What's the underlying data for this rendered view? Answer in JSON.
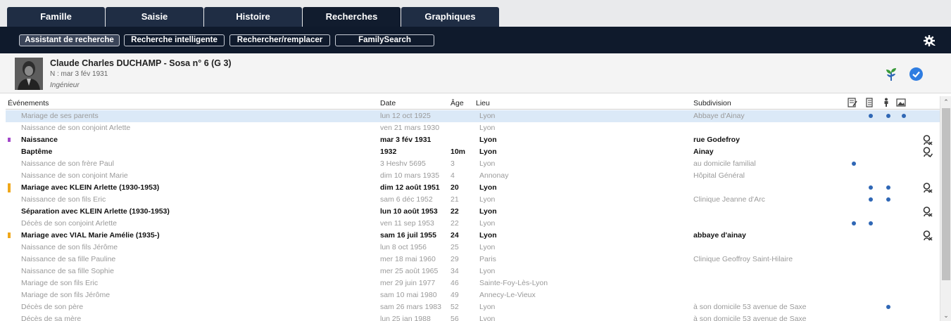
{
  "tabs": [
    "Famille",
    "Saisie",
    "Histoire",
    "Recherches",
    "Graphiques"
  ],
  "active_tab": "Recherches",
  "toolbar": {
    "buttons": [
      "Assistant de recherche",
      "Recherche intelligente",
      "Rechercher/remplacer",
      "FamilySearch"
    ]
  },
  "person": {
    "name": "Claude Charles DUCHAMP - Sosa n° 6 (G 3)",
    "birth": "N : mar 3 fév 1931",
    "occupation": "Ingénieur"
  },
  "table": {
    "headers": [
      "Événements",
      "Date",
      "Âge",
      "Lieu",
      "Subdivision"
    ],
    "header_icons": [
      "notes-icon",
      "sources-icon",
      "person-icon",
      "media-icon"
    ],
    "rows": [
      {
        "event": "Mariage de ses parents",
        "date": "lun 12 oct 1925",
        "age": "",
        "place": "Lyon",
        "sub": "Abbaye d'Ainay"
      },
      {
        "event": "Naissance de son conjoint Arlette",
        "date": "ven 21 mars 1930",
        "age": "",
        "place": "Lyon",
        "sub": ""
      },
      {
        "event": "Naissance",
        "date": "mar 3 fév 1931",
        "age": "",
        "place": "Lyon",
        "sub": "rue Godefroy"
      },
      {
        "event": "Baptême",
        "date": "1932",
        "age": "10m",
        "place": "Lyon",
        "sub": "Ainay"
      },
      {
        "event": "Naissance de son frère Paul",
        "date": "3 Heshv 5695",
        "age": "3",
        "place": "Lyon",
        "sub": "au domicile familial"
      },
      {
        "event": "Naissance de son conjoint Marie",
        "date": "dim 10 mars 1935",
        "age": "4",
        "place": "Annonay",
        "sub": "Hôpital Général"
      },
      {
        "event": "Mariage avec KLEIN Arlette (1930-1953)",
        "date": "dim 12 août 1951",
        "age": "20",
        "place": "Lyon",
        "sub": ""
      },
      {
        "event": "Naissance de son fils Eric",
        "date": "sam 6 déc 1952",
        "age": "21",
        "place": "Lyon",
        "sub": "Clinique Jeanne d'Arc"
      },
      {
        "event": "Séparation avec KLEIN Arlette (1930-1953)",
        "date": "lun 10 août 1953",
        "age": "22",
        "place": "Lyon",
        "sub": ""
      },
      {
        "event": "Décès de son conjoint Arlette",
        "date": "ven 11 sep 1953",
        "age": "22",
        "place": "Lyon",
        "sub": ""
      },
      {
        "event": "Mariage avec VIAL Marie Amélie (1935-)",
        "date": "sam 16 juil 1955",
        "age": "24",
        "place": "Lyon",
        "sub": "abbaye d'ainay"
      },
      {
        "event": "Naissance de son fils Jérôme",
        "date": "lun 8 oct 1956",
        "age": "25",
        "place": "Lyon",
        "sub": ""
      },
      {
        "event": "Naissance de sa fille Pauline",
        "date": "mer 18 mai 1960",
        "age": "29",
        "place": "Paris",
        "sub": "Clinique Geoffroy Saint-Hilaire"
      },
      {
        "event": "Naissance de sa fille Sophie",
        "date": "mer 25 août 1965",
        "age": "34",
        "place": "Lyon",
        "sub": ""
      },
      {
        "event": "Mariage de son fils Eric",
        "date": "mer 29 juin 1977",
        "age": "46",
        "place": "Sainte-Foy-Lès-Lyon",
        "sub": ""
      },
      {
        "event": "Mariage de son fils Jérôme",
        "date": "sam 10 mai 1980",
        "age": "49",
        "place": "Annecy-Le-Vieux",
        "sub": ""
      },
      {
        "event": "Décès de son père",
        "date": "sam 26 mars 1983",
        "age": "52",
        "place": "Lyon",
        "sub": "à son domicile 53 avenue de Saxe"
      },
      {
        "event": "Décès de sa mère",
        "date": "lun 25 jan 1988",
        "age": "56",
        "place": "Lyon",
        "sub": "à son domicile 53 avenue de Saxe"
      }
    ]
  },
  "colors": {
    "tab_bg": "#1f2d44",
    "toolbar_bg": "#0f1a2c",
    "selected_row": "#dbe9f7",
    "dot": "#2f67b5",
    "mark_purple": "#a347c9",
    "mark_orange": "#f0a81a"
  }
}
